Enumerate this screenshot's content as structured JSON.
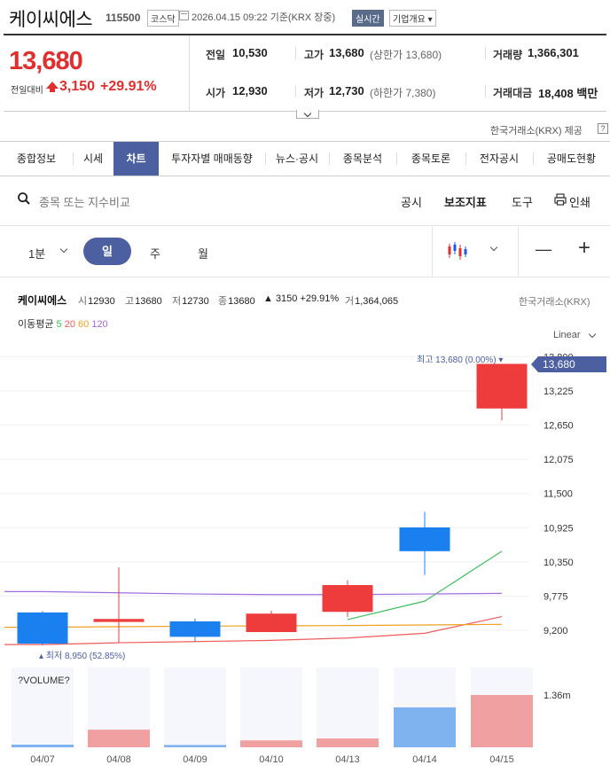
{
  "header": {
    "name": "케이씨에스",
    "code": "115500",
    "market": "코스닥",
    "datetime": "2026.04.15 09:22 기준(KRX 장중)",
    "realtime": "실시간",
    "overview": "기업개요 ▾"
  },
  "price": {
    "current": "13,680",
    "change_label": "전일대비",
    "change": "3,150",
    "change_pct": "+29.91%"
  },
  "quote": {
    "prev_label": "전일",
    "prev": "10,530",
    "high_label": "고가",
    "high": "13,680",
    "upper_limit": "(상한가 13,680)",
    "volume_label": "거래량",
    "volume": "1,366,301",
    "open_label": "시가",
    "open": "12,930",
    "low_label": "저가",
    "low": "12,730",
    "lower_limit": "(하한가 7,380)",
    "amount_label": "거래대금",
    "amount": "18,408 백만"
  },
  "source_note": "한국거래소(KRX) 제공",
  "help": "?",
  "tabs": [
    "종합정보",
    "시세",
    "차트",
    "투자자별 매매동향",
    "뉴스·공시",
    "종목분석",
    "종목토론",
    "전자공시",
    "공매도현황"
  ],
  "active_tab": "차트",
  "toolbar": {
    "search_placeholder": "종목 또는 지수비교",
    "notice": "공시",
    "indicator": "보조지표",
    "tools": "도구",
    "print": "인쇄"
  },
  "periods": {
    "minute": "1분",
    "day": "일",
    "week": "주",
    "month": "월"
  },
  "zoom": {
    "out": "—",
    "in": "+"
  },
  "chart_info": {
    "name": "케이씨에스",
    "open_k": "시",
    "open": "12930",
    "high_k": "고",
    "high": "13680",
    "low_k": "저",
    "low": "12730",
    "close_k": "종",
    "close": "13680",
    "change": "▲ 3150 +29.91%",
    "volume_k": "거",
    "volume": "1,364,065",
    "ma_label": "이동평균",
    "ma": [
      "5",
      "20",
      "60",
      "120"
    ],
    "ma_colors": [
      "#3ec05a",
      "#ef5b5b",
      "#f0a020",
      "#a06ce0"
    ],
    "exchange": "한국거래소(KRX)",
    "scale": "Linear"
  },
  "chart_data": {
    "type": "candlestick",
    "x": [
      "04/07",
      "04/08",
      "04/09",
      "04/10",
      "04/13",
      "04/14",
      "04/15"
    ],
    "candles": [
      {
        "date": "04/07",
        "open": 9500,
        "high": 9520,
        "low": 8950,
        "close": 8975
      },
      {
        "date": "04/08",
        "open": 9340,
        "high": 10260,
        "low": 8990,
        "close": 9390
      },
      {
        "date": "04/09",
        "open": 9350,
        "high": 9400,
        "low": 9010,
        "close": 9090
      },
      {
        "date": "04/10",
        "open": 9170,
        "high": 9530,
        "low": 9170,
        "close": 9480
      },
      {
        "date": "04/13",
        "open": 9510,
        "high": 10040,
        "low": 9420,
        "close": 9960
      },
      {
        "date": "04/14",
        "open": 10930,
        "high": 11190,
        "low": 10130,
        "close": 10530
      },
      {
        "date": "04/15",
        "open": 12930,
        "high": 13680,
        "low": 12730,
        "close": 13680
      }
    ],
    "moving_averages": [
      {
        "name": "5",
        "values": [
          null,
          null,
          null,
          null,
          9380,
          9690,
          10530
        ]
      },
      {
        "name": "20",
        "values": [
          8960,
          8990,
          9010,
          9030,
          9070,
          9150,
          9430
        ]
      },
      {
        "name": "60",
        "values": [
          9250,
          9260,
          9270,
          9275,
          9280,
          9290,
          9300
        ]
      },
      {
        "name": "120",
        "values": [
          9850,
          9830,
          9810,
          9800,
          9800,
          9810,
          9820
        ]
      }
    ],
    "volume": [
      70000,
      460000,
      60000,
      180000,
      230000,
      1040000,
      1364065
    ],
    "y_ticks": [
      9200,
      9775,
      10350,
      10925,
      11500,
      12075,
      12650,
      13225,
      13800
    ],
    "y_tick_labels": [
      "9,200",
      "9,775",
      "10,350",
      "10,925",
      "11,500",
      "12,075",
      "12,650",
      "13,225",
      "13,800"
    ],
    "max_label": "최고 13,680 (0.00%)",
    "min_label": "최저 8,950 (52.85%)",
    "last_label": "13,680",
    "volume_title": "?VOLUME?",
    "volume_tick": "1.36m",
    "up_color": "#ee3b3b",
    "down_color": "#1a80f0"
  }
}
